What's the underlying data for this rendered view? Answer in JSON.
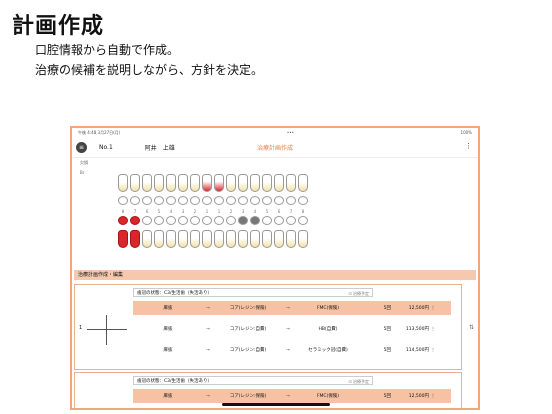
{
  "heading": "計画作成",
  "subtitle1": "口腔情報から自動で作成。",
  "subtitle2": "治療の候補を説明しながら、方針を決定。",
  "status": {
    "time": "午後 4:48  3月27日(月)",
    "dots": "•••",
    "battery": "100%"
  },
  "app": {
    "menu_icon": "menu-icon",
    "patient_no": "No.1",
    "patient_name": "阿井　上雄",
    "title": "治療計画作成",
    "more": "⋮"
  },
  "chart_labels": {
    "upper1": "欠損",
    "upper2": "Br",
    "lower": "Br"
  },
  "tooth_numbers_upper": [
    "8",
    "7",
    "6",
    "5",
    "4",
    "3",
    "2",
    "1",
    "1",
    "2",
    "3",
    "4",
    "5",
    "6",
    "7",
    "8"
  ],
  "section": "治療計画作成・編集",
  "plans": [
    {
      "state": "歯冠の状態：C3/生活歯（失活あり）",
      "copy": "⊡ 治療予定",
      "label": "1",
      "rows": [
        {
          "a": "麻抜",
          "b": "コア(レジン:保険)",
          "c": "FMC(保険)",
          "cnt": "5回",
          "price": "12,500円",
          "selected": true
        },
        {
          "a": "麻抜",
          "b": "コア(レジン:自費)",
          "c": "HB(自費)",
          "cnt": "5回",
          "price": "113,500円",
          "selected": false
        },
        {
          "a": "麻抜",
          "b": "コア(レジン:自費)",
          "c": "セラミック冠(自費)",
          "cnt": "5回",
          "price": "114,500円",
          "selected": false
        }
      ]
    },
    {
      "state": "歯冠の状態：C3/生活歯（失活あり）",
      "copy": "⊡ 治療予定",
      "label": "",
      "rows": [
        {
          "a": "麻抜",
          "b": "コア(レジン:保険)",
          "c": "FMC(保険)",
          "cnt": "5回",
          "price": "12,500円",
          "selected": true
        }
      ]
    }
  ],
  "arrow": "→",
  "side_control": "⇅",
  "colors": {
    "accent": "#e07f4c",
    "frame": "#f0a77a",
    "selected": "#f6c2a3",
    "red": "#d9262d"
  }
}
